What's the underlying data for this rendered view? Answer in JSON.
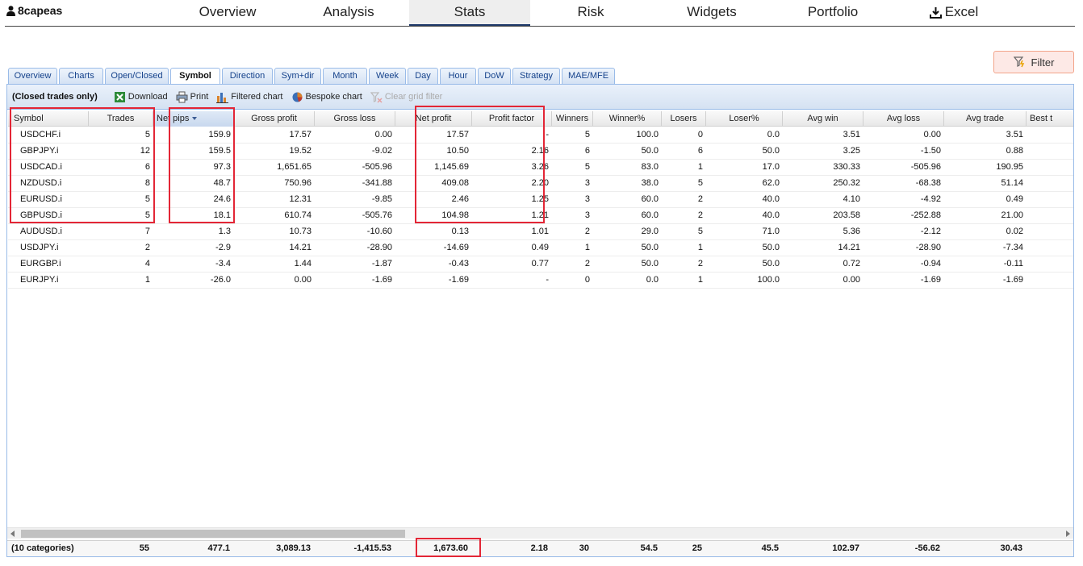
{
  "user": {
    "name": "8capeas"
  },
  "nav": {
    "overview": "Overview",
    "analysis": "Analysis",
    "stats": "Stats",
    "risk": "Risk",
    "widgets": "Widgets",
    "portfolio": "Portfolio",
    "excel": "Excel"
  },
  "filter_label": "Filter",
  "tabs": [
    "Overview",
    "Charts",
    "Open/Closed",
    "Symbol",
    "Direction",
    "Sym+dir",
    "Month",
    "Week",
    "Day",
    "Hour",
    "DoW",
    "Strategy",
    "MAE/MFE"
  ],
  "active_tab": "Symbol",
  "toolbar": {
    "title": "(Closed trades only)",
    "download": "Download",
    "print": "Print",
    "filtered_chart": "Filtered chart",
    "bespoke_chart": "Bespoke chart",
    "clear_filter": "Clear grid filter"
  },
  "columns": [
    "Symbol",
    "Trades",
    "Net pips",
    "Gross profit",
    "Gross loss",
    "Net profit",
    "Profit factor",
    "Winners",
    "Winner%",
    "Losers",
    "Loser%",
    "Avg win",
    "Avg loss",
    "Avg trade",
    "Best t"
  ],
  "rows": [
    [
      "USDCHF.i",
      "5",
      "159.9",
      "17.57",
      "0.00",
      "17.57",
      "-",
      "5",
      "100.0",
      "0",
      "0.0",
      "3.51",
      "0.00",
      "3.51"
    ],
    [
      "GBPJPY.i",
      "12",
      "159.5",
      "19.52",
      "-9.02",
      "10.50",
      "2.16",
      "6",
      "50.0",
      "6",
      "50.0",
      "3.25",
      "-1.50",
      "0.88"
    ],
    [
      "USDCAD.i",
      "6",
      "97.3",
      "1,651.65",
      "-505.96",
      "1,145.69",
      "3.26",
      "5",
      "83.0",
      "1",
      "17.0",
      "330.33",
      "-505.96",
      "190.95"
    ],
    [
      "NZDUSD.i",
      "8",
      "48.7",
      "750.96",
      "-341.88",
      "409.08",
      "2.20",
      "3",
      "38.0",
      "5",
      "62.0",
      "250.32",
      "-68.38",
      "51.14"
    ],
    [
      "EURUSD.i",
      "5",
      "24.6",
      "12.31",
      "-9.85",
      "2.46",
      "1.25",
      "3",
      "60.0",
      "2",
      "40.0",
      "4.10",
      "-4.92",
      "0.49"
    ],
    [
      "GBPUSD.i",
      "5",
      "18.1",
      "610.74",
      "-505.76",
      "104.98",
      "1.21",
      "3",
      "60.0",
      "2",
      "40.0",
      "203.58",
      "-252.88",
      "21.00"
    ],
    [
      "AUDUSD.i",
      "7",
      "1.3",
      "10.73",
      "-10.60",
      "0.13",
      "1.01",
      "2",
      "29.0",
      "5",
      "71.0",
      "5.36",
      "-2.12",
      "0.02"
    ],
    [
      "USDJPY.i",
      "2",
      "-2.9",
      "14.21",
      "-28.90",
      "-14.69",
      "0.49",
      "1",
      "50.0",
      "1",
      "50.0",
      "14.21",
      "-28.90",
      "-7.34"
    ],
    [
      "EURGBP.i",
      "4",
      "-3.4",
      "1.44",
      "-1.87",
      "-0.43",
      "0.77",
      "2",
      "50.0",
      "2",
      "50.0",
      "0.72",
      "-0.94",
      "-0.11"
    ],
    [
      "EURJPY.i",
      "1",
      "-26.0",
      "0.00",
      "-1.69",
      "-1.69",
      "-",
      "0",
      "0.0",
      "1",
      "100.0",
      "0.00",
      "-1.69",
      "-1.69"
    ]
  ],
  "summary": [
    "(10 categories)",
    "55",
    "477.1",
    "3,089.13",
    "-1,415.53",
    "1,673.60",
    "2.18",
    "30",
    "54.5",
    "25",
    "45.5",
    "102.97",
    "-56.62",
    "30.43"
  ],
  "colors": {
    "highlight": "#e32636",
    "tab_border": "#99bbe8",
    "tab_text": "#15428b"
  }
}
